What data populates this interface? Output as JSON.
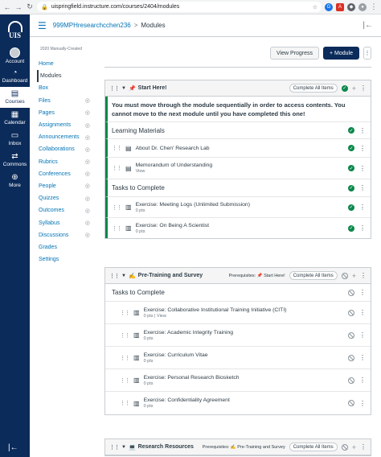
{
  "browser": {
    "url": "uispringfield.instructure.com/courses/2404/modules"
  },
  "global_nav": {
    "logo_text": "UIS",
    "items": [
      {
        "label": "Account",
        "icon": "account-icon"
      },
      {
        "label": "Dashboard",
        "icon": "dashboard-icon"
      },
      {
        "label": "Courses",
        "icon": "courses-icon",
        "active": true
      },
      {
        "label": "Calendar",
        "icon": "calendar-icon"
      },
      {
        "label": "Inbox",
        "icon": "inbox-icon"
      },
      {
        "label": "Commons",
        "icon": "commons-icon"
      },
      {
        "label": "More",
        "icon": "more-icon"
      }
    ]
  },
  "header": {
    "course": "999MPHresearchcchen236",
    "separator": ">",
    "current": "Modules"
  },
  "course_nav": {
    "term": "2020 Manually-Created",
    "items": [
      {
        "label": "Home",
        "hidden": false
      },
      {
        "label": "Modules",
        "hidden": false,
        "active": true
      },
      {
        "label": "Box",
        "hidden": false
      },
      {
        "label": "Files",
        "hidden": true
      },
      {
        "label": "Pages",
        "hidden": true
      },
      {
        "label": "Assignments",
        "hidden": true
      },
      {
        "label": "Announcements",
        "hidden": true
      },
      {
        "label": "Collaborations",
        "hidden": true
      },
      {
        "label": "Rubrics",
        "hidden": true
      },
      {
        "label": "Conferences",
        "hidden": true
      },
      {
        "label": "People",
        "hidden": true
      },
      {
        "label": "Quizzes",
        "hidden": true
      },
      {
        "label": "Outcomes",
        "hidden": true
      },
      {
        "label": "Syllabus",
        "hidden": true
      },
      {
        "label": "Discussions",
        "hidden": true
      },
      {
        "label": "Grades",
        "hidden": false
      },
      {
        "label": "Settings",
        "hidden": false
      }
    ]
  },
  "toolbar": {
    "view_progress": "View Progress",
    "add_module": "+ Module"
  },
  "modules": [
    {
      "title": "Start Here!",
      "emoji": "📌",
      "complete_all": "Complete All Items",
      "notice": "You must move through the module sequentially in order to access contents. You cannot move to the next module until you have completed this one!",
      "sections": [
        {
          "header": "Learning Materials",
          "items": [
            {
              "title": "About Dr. Chen' Research Lab",
              "meta": ""
            },
            {
              "title": "Memorandum of Understanding",
              "meta": "View"
            }
          ]
        },
        {
          "header": "Tasks to Complete",
          "items": [
            {
              "title": "Exercise: Meeting Logs (Unlimited Submission)",
              "meta": "0 pts"
            },
            {
              "title": "Exercise: On Being A Scientist",
              "meta": "0 pts"
            }
          ]
        }
      ]
    },
    {
      "title": "Pre-Training and Survey",
      "emoji": "✍",
      "prerequisites": "Prerequisites: 📌 Start Here!",
      "complete_all": "Complete All Items",
      "section_header": "Tasks to Complete",
      "items": [
        {
          "title": "Exercise: Collaborative Institutional Training Initiative (CITI)",
          "meta": "0 pts",
          "meta2": "View"
        },
        {
          "title": "Exercise: Academic Integrity Training",
          "meta": "0 pts"
        },
        {
          "title": "Exercise: Curriculum Vitae",
          "meta": "0 pts"
        },
        {
          "title": "Exercise: Personal Research Biosketch",
          "meta": "0 pts"
        },
        {
          "title": "Exercise: Confidentiality Agreement",
          "meta": "0 pts"
        }
      ]
    },
    {
      "title": "Research Resources",
      "emoji": "💻",
      "prerequisites": "Prerequisites: ✍ Pre-Training and Survey",
      "complete_all": "Complete All Items"
    }
  ],
  "colors": {
    "nav_bg": "#0b2b5a",
    "link": "#0374b5",
    "complete_green": "#0b874b"
  }
}
